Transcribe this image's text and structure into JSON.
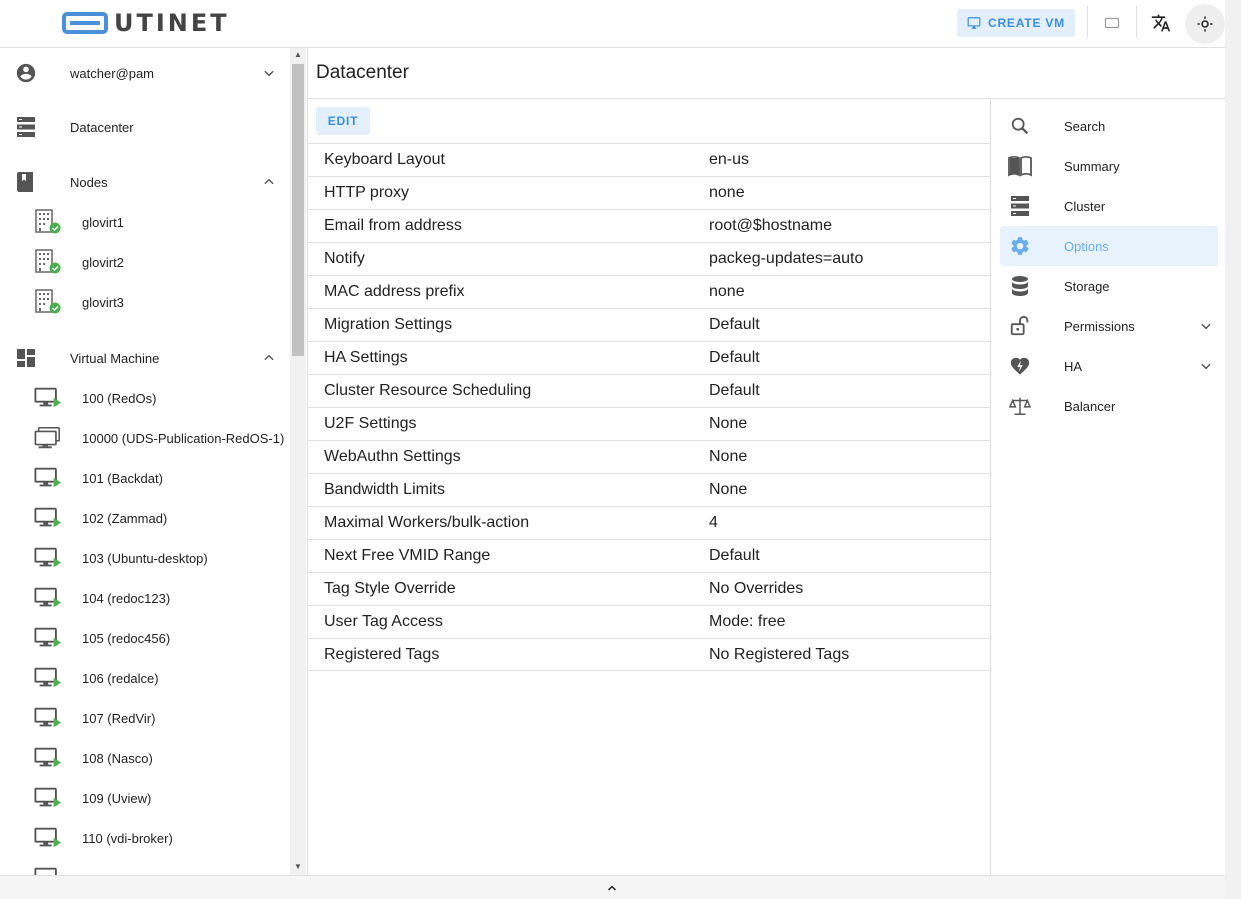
{
  "app": {
    "logo_text": "UTINET",
    "create_vm_label": "CREATE VM"
  },
  "tree": {
    "user": "watcher@pam",
    "datacenter": "Datacenter",
    "nodes_label": "Nodes",
    "nodes": [
      "glovirt1",
      "glovirt2",
      "glovirt3"
    ],
    "vm_label": "Virtual Machine",
    "vms": [
      "100 (RedOs)",
      "10000 (UDS-Publication-RedOS-1)",
      "101 (Backdat)",
      "102 (Zammad)",
      "103 (Ubuntu-desktop)",
      "104 (redoc123)",
      "105 (redoc456)",
      "106 (redalce)",
      "107 (RedVir)",
      "108 (Nasco)",
      "109 (Uview)",
      "110 (vdi-broker)"
    ]
  },
  "main": {
    "title": "Datacenter",
    "edit_label": "EDIT",
    "options": [
      {
        "name": "Keyboard Layout",
        "value": "en-us"
      },
      {
        "name": "HTTP proxy",
        "value": "none"
      },
      {
        "name": "Email from address",
        "value": "root@$hostname"
      },
      {
        "name": "Notify",
        "value": "packeg-updates=auto"
      },
      {
        "name": "MAC address prefix",
        "value": "none"
      },
      {
        "name": "Migration Settings",
        "value": "Default"
      },
      {
        "name": "HA Settings",
        "value": "Default"
      },
      {
        "name": "Cluster Resource Scheduling",
        "value": "Default"
      },
      {
        "name": "U2F Settings",
        "value": "None"
      },
      {
        "name": "WebAuthn Settings",
        "value": "None"
      },
      {
        "name": "Bandwidth Limits",
        "value": "None"
      },
      {
        "name": "Maximal Workers/bulk-action",
        "value": "4"
      },
      {
        "name": "Next Free VMID Range",
        "value": "Default"
      },
      {
        "name": "Tag Style Override",
        "value": "No Overrides"
      },
      {
        "name": "User Tag Access",
        "value": "Mode: free"
      },
      {
        "name": "Registered Tags",
        "value": "No Registered Tags"
      }
    ]
  },
  "rnav": {
    "items": [
      {
        "label": "Search",
        "icon": "search-icon"
      },
      {
        "label": "Summary",
        "icon": "book-icon"
      },
      {
        "label": "Cluster",
        "icon": "server-icon"
      },
      {
        "label": "Options",
        "icon": "gear-icon",
        "selected": true
      },
      {
        "label": "Storage",
        "icon": "database-icon"
      },
      {
        "label": "Permissions",
        "icon": "unlock-icon",
        "expandable": true
      },
      {
        "label": "HA",
        "icon": "heart-pulse-icon",
        "expandable": true
      },
      {
        "label": "Balancer",
        "icon": "scale-icon"
      }
    ]
  },
  "colors": {
    "accent": "#3a8ee6",
    "accent_bg": "#e3f0fb",
    "selected_text": "#6aacf0",
    "status_ok": "#4caf50"
  }
}
